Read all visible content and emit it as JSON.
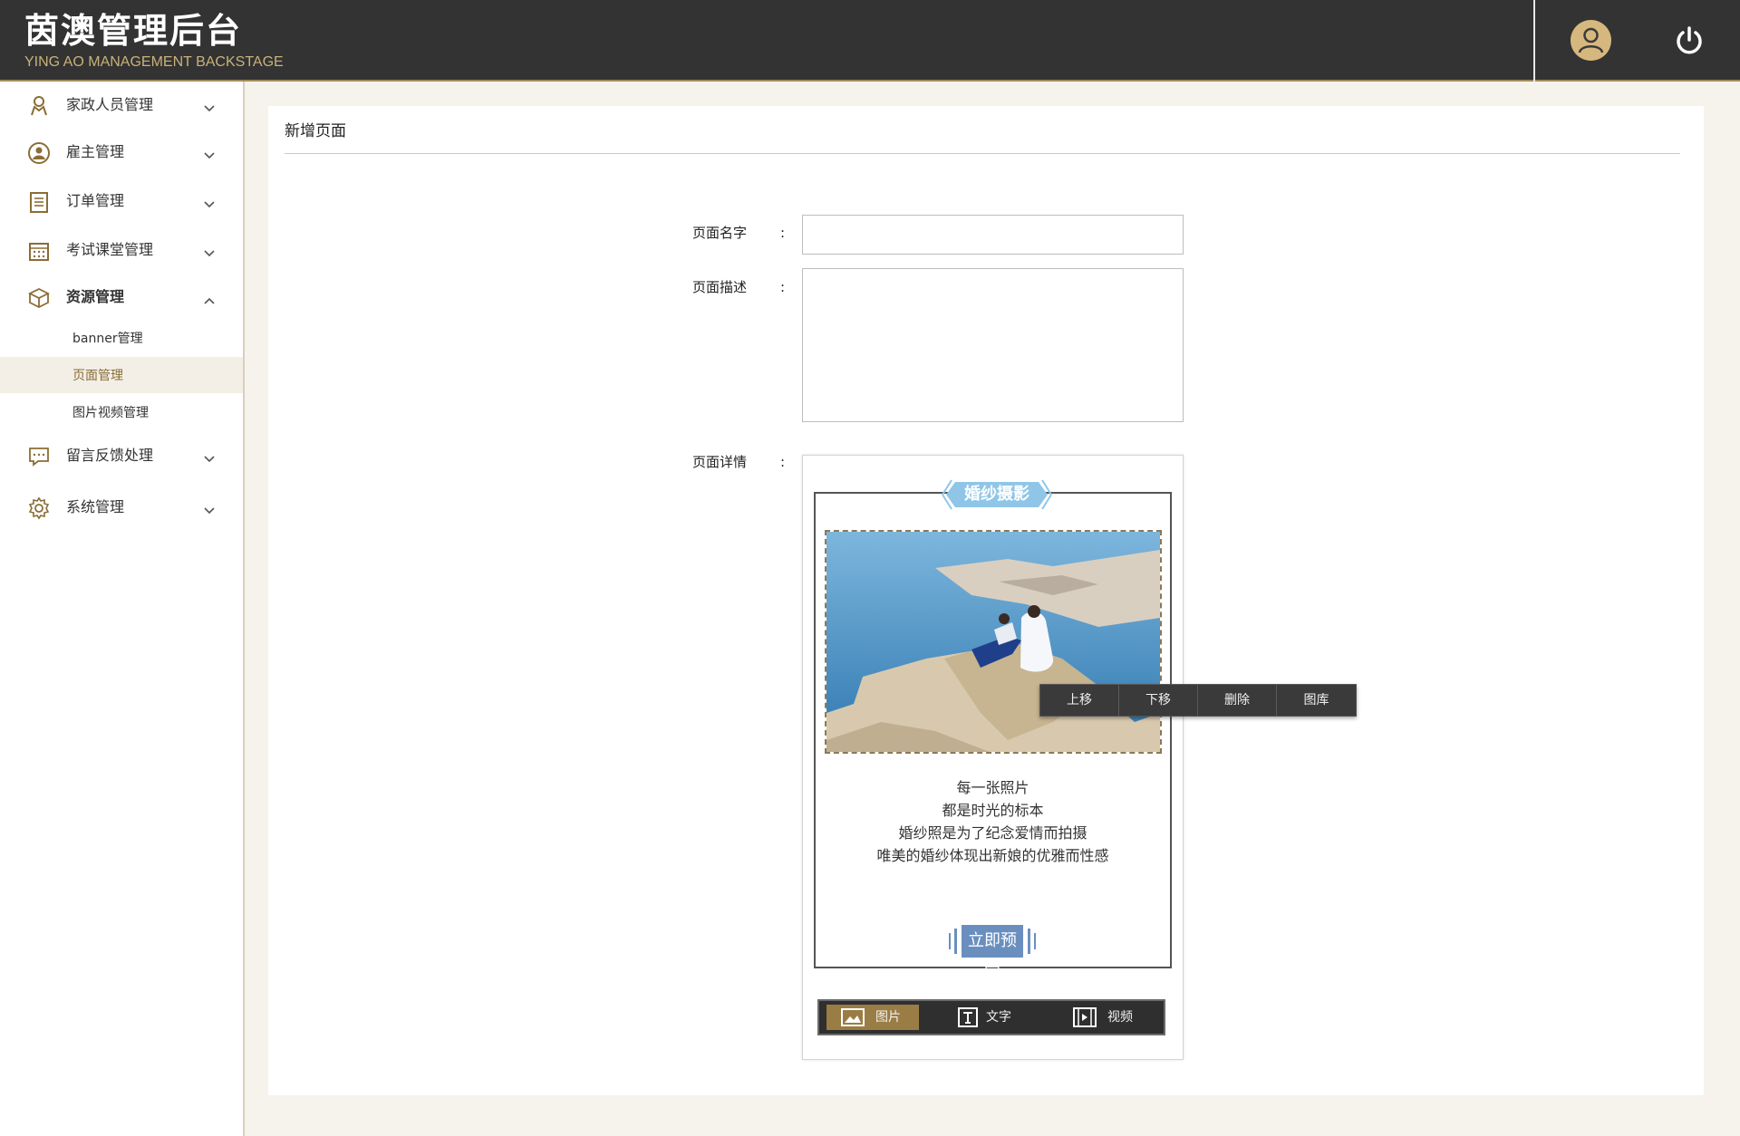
{
  "header": {
    "title": "茵澳管理后台",
    "subtitle": "YING AO MANAGEMENT BACKSTAGE",
    "colors": {
      "bg": "#333333",
      "accent": "#c9b27a"
    },
    "avatar_icon": "user-avatar-icon",
    "power_icon": "power-icon"
  },
  "sidebar": {
    "items": [
      {
        "label": "家政人员管理",
        "icon": "housekeeper-icon",
        "expanded": false
      },
      {
        "label": "雇主管理",
        "icon": "employer-icon",
        "expanded": false
      },
      {
        "label": "订单管理",
        "icon": "order-icon",
        "expanded": false
      },
      {
        "label": "考试课堂管理",
        "icon": "calendar-icon",
        "expanded": false
      },
      {
        "label": "资源管理",
        "icon": "cube-icon",
        "expanded": true,
        "children": [
          {
            "label": "banner管理"
          },
          {
            "label": "页面管理",
            "active": true
          },
          {
            "label": "图片视频管理"
          }
        ]
      },
      {
        "label": "留言反馈处理",
        "icon": "message-icon",
        "expanded": false
      },
      {
        "label": "系统管理",
        "icon": "gear-icon",
        "expanded": false
      }
    ]
  },
  "main": {
    "title": "新增页面",
    "form": {
      "colon": ":",
      "name_label": "页面名字",
      "name_value": "",
      "desc_label": "页面描述",
      "desc_value": "",
      "detail_label": "页面详情"
    },
    "preview": {
      "ribbon": "婚纱摄影",
      "captions": [
        "每一张照片",
        "都是时光的标本",
        "婚纱照是为了纪念爱情而拍摄",
        "唯美的婚纱体现出新娘的优雅而性感"
      ],
      "book_button": "立即预定",
      "popup": [
        "上移",
        "下移",
        "删除",
        "图库"
      ],
      "toolbar": [
        {
          "label": "图片",
          "icon": "image-icon",
          "active": true
        },
        {
          "label": "文字",
          "icon": "text-icon",
          "active": false
        },
        {
          "label": "视频",
          "icon": "video-icon",
          "active": false
        }
      ]
    }
  }
}
